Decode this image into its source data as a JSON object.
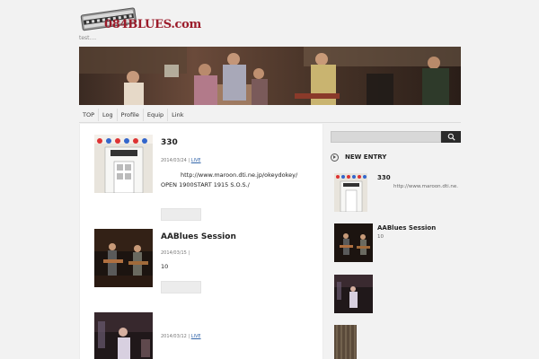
{
  "site": {
    "logo_text": "084BLUES.com",
    "tagline": "test....",
    "colors": {
      "accent": "#9b1b2a",
      "link": "#3366aa",
      "search_button": "#2b2b2b"
    },
    "icons": {
      "logo": "harmonica-icon",
      "search": "search-icon",
      "section": "circle-arrow-icon"
    }
  },
  "nav": {
    "items": [
      {
        "label": "TOP"
      },
      {
        "label": "Log"
      },
      {
        "label": "Profile"
      },
      {
        "label": "Equip"
      },
      {
        "label": "Link"
      }
    ]
  },
  "posts": [
    {
      "title": "330",
      "date": "2014/03/24",
      "separator": "|",
      "category": "LIVE",
      "body_lines": [
        "http://www.maroon.dti.ne.jp/okeydokey/",
        "OPEN 1900START 1915 S.O.S./"
      ]
    },
    {
      "title": "AABlues Session",
      "date": "2014/03/15",
      "separator": "|",
      "category": "",
      "body_lines": [
        "10"
      ]
    },
    {
      "title": "",
      "date": "2014/03/12",
      "separator": "|",
      "category": "LIVE",
      "body_lines": []
    }
  ],
  "sidebar": {
    "search": {
      "value": "",
      "placeholder": ""
    },
    "new_entry": {
      "heading": "NEW ENTRY",
      "entries": [
        {
          "title": "330",
          "text": "http://www.maroon.dti.ne."
        },
        {
          "title": "AABlues Session",
          "text": "10"
        },
        {
          "title": "",
          "text": ""
        },
        {
          "title": "",
          "text": ""
        }
      ]
    }
  }
}
